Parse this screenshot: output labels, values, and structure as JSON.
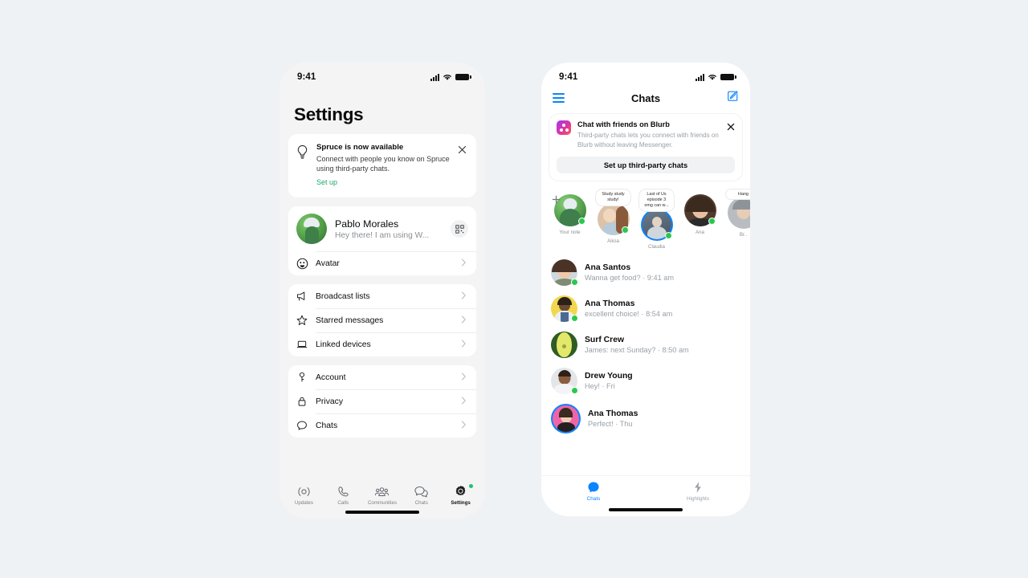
{
  "background_color": "#eff2f5",
  "phones": {
    "left": {
      "app": "WhatsApp Settings",
      "status_bar": {
        "time": "9:41",
        "signal_icon": "cellular-signal-icon",
        "wifi_icon": "wifi-icon",
        "battery_icon": "battery-icon"
      },
      "page_title": "Settings",
      "promo": {
        "icon": "lightbulb-icon",
        "title": "Spruce is now available",
        "description": "Connect with people you know on Spruce using third-party chats.",
        "link": "Set up",
        "link_color": "#1aab6b",
        "close_icon": "close-icon"
      },
      "profile": {
        "name": "Pablo Morales",
        "status": "Hey there! I am using W...",
        "qr_icon": "qr-code-icon",
        "avatar": "avatar-image"
      },
      "groups": [
        {
          "rows": [
            {
              "icon": "avatar-smiley-icon",
              "label": "Avatar"
            }
          ]
        },
        {
          "rows": [
            {
              "icon": "megaphone-icon",
              "label": "Broadcast lists"
            },
            {
              "icon": "star-icon",
              "label": "Starred messages"
            },
            {
              "icon": "laptop-icon",
              "label": "Linked devices"
            }
          ]
        },
        {
          "rows": [
            {
              "icon": "key-icon",
              "label": "Account"
            },
            {
              "icon": "lock-icon",
              "label": "Privacy"
            },
            {
              "icon": "chat-bubble-icon",
              "label": "Chats"
            }
          ]
        }
      ],
      "tabs": [
        {
          "label": "Updates",
          "icon": "updates-icon",
          "active": false,
          "badge": false
        },
        {
          "label": "Calls",
          "icon": "phone-icon",
          "active": false,
          "badge": false
        },
        {
          "label": "Communities",
          "icon": "communities-icon",
          "active": false,
          "badge": false
        },
        {
          "label": "Chats",
          "icon": "chats-icon",
          "active": false,
          "badge": false
        },
        {
          "label": "Settings",
          "icon": "gear-icon",
          "active": true,
          "badge": true
        }
      ],
      "badge_color": "#23c16b"
    },
    "right": {
      "app": "Messenger",
      "status_bar": {
        "time": "9:41",
        "signal_icon": "cellular-signal-icon",
        "wifi_icon": "wifi-icon",
        "battery_icon": "battery-icon"
      },
      "header": {
        "menu_icon": "hamburger-menu-icon",
        "title": "Chats",
        "compose_icon": "compose-icon",
        "accent_color": "#0b84ff"
      },
      "blurb_banner": {
        "app_icon": "blurb-app-icon",
        "title": "Chat with friends on Blurb",
        "description": "Third-party chats lets you connect with friends on Blurb without leaving Messenger.",
        "close_icon": "close-icon",
        "button_label": "Set up third-party chats"
      },
      "notes": [
        {
          "name": "Your note",
          "bubble": "",
          "online": true,
          "ring": false,
          "add": true
        },
        {
          "name": "Alicia",
          "bubble": "Study study study!",
          "online": true,
          "ring": false,
          "add": false
        },
        {
          "name": "Claudia",
          "bubble": "Last of Us episode 3 omg can w...",
          "online": true,
          "ring": true,
          "add": false
        },
        {
          "name": "Ana",
          "bubble": "",
          "online": true,
          "ring": false,
          "add": false
        },
        {
          "name": "Br..",
          "bubble": "Hang",
          "online": false,
          "ring": false,
          "add": false
        }
      ],
      "chats": [
        {
          "name": "Ana Santos",
          "preview": "Wanna get food? · 9:41 am",
          "online": true,
          "ring": false
        },
        {
          "name": "Ana Thomas",
          "preview": "excellent choice! · 8:54 am",
          "online": true,
          "ring": false
        },
        {
          "name": "Surf Crew",
          "preview": "James: next Sunday? · 8:50 am",
          "online": false,
          "ring": false
        },
        {
          "name": "Drew Young",
          "preview": "Hey! · Fri",
          "online": true,
          "ring": false
        },
        {
          "name": "Ana Thomas",
          "preview": "Perfect! · Thu",
          "online": false,
          "ring": true
        }
      ],
      "tabs": [
        {
          "label": "Chats",
          "icon": "chat-bubble-icon",
          "active": true
        },
        {
          "label": "Highlights",
          "icon": "lightning-bolt-icon",
          "active": false
        }
      ]
    }
  }
}
